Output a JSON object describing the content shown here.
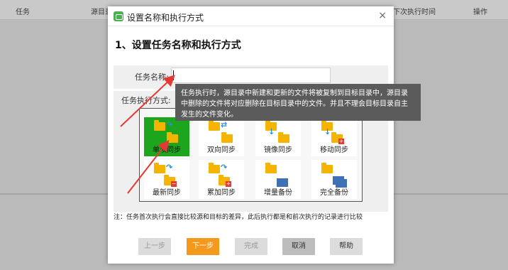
{
  "background_table": {
    "columns": [
      "任务",
      "源目录",
      "下次执行时间",
      "操作"
    ]
  },
  "dialog": {
    "title": "设置名称和执行方式",
    "close_glyph": "×",
    "heading": "1、设置任务名称和执行方式",
    "name_label": "任务名称:",
    "name_value": "",
    "mode_label": "任务执行方式:",
    "modes": [
      {
        "label": "单项同步",
        "selected": true
      },
      {
        "label": "双向同步",
        "selected": false
      },
      {
        "label": "镜像同步",
        "selected": false
      },
      {
        "label": "移动同步",
        "selected": false
      },
      {
        "label": "最新同步",
        "selected": false
      },
      {
        "label": "累加同步",
        "selected": false
      },
      {
        "label": "增量备份",
        "selected": false
      },
      {
        "label": "完全备份",
        "selected": false
      }
    ],
    "note": "注：任务首次执行会直接比较源和目标的差异，此后执行都是和前次执行的记录进行比较",
    "buttons": {
      "prev": "上一步",
      "next": "下一步",
      "finish": "完成",
      "cancel": "取消",
      "help": "帮助"
    }
  },
  "tooltip": {
    "lines": [
      "任务执行时，源目录中新建和更新的文件将被复制到目标目录中，源目录",
      "中删除的文件将对应删除在目标目录中的文件。并且不理会目标目录自主",
      "发生的文件变化。"
    ]
  },
  "colors": {
    "selected_tile": "#1ea51e",
    "primary_button": "#f39a1e",
    "annotation_arrow": "#e53935",
    "tooltip_bg": "#5b5b5b"
  }
}
